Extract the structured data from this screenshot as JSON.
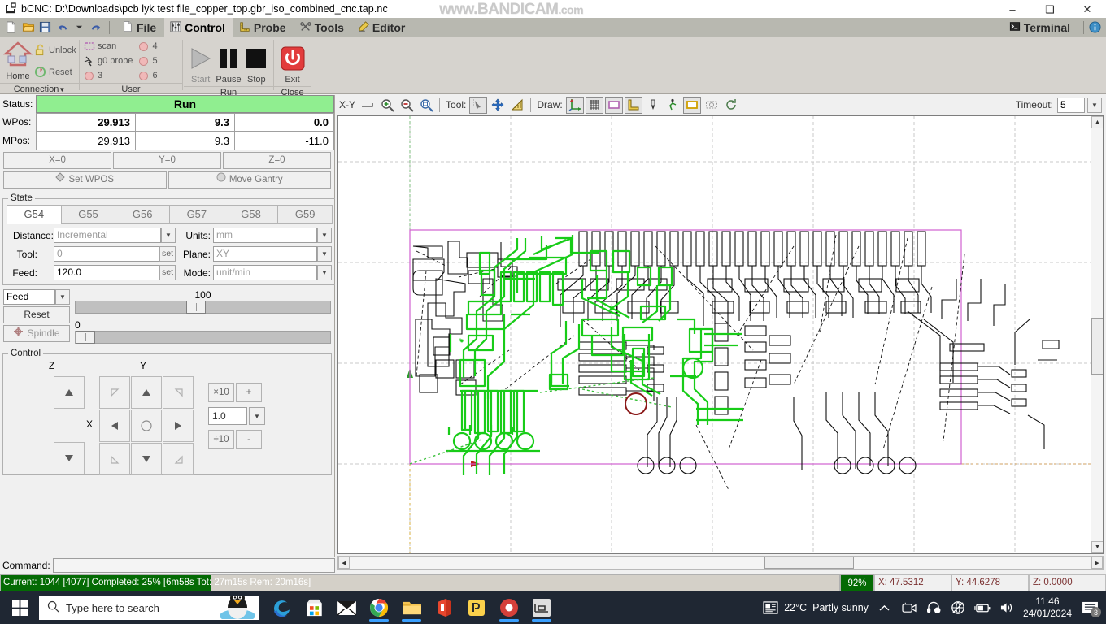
{
  "window": {
    "title": "bCNC: D:\\Downloads\\pcb lyk test file_copper_top.gbr_iso_combined_cnc.tap.nc",
    "icon": "bcnc-icon",
    "minimize": "–",
    "maximize": "❑",
    "close": "✕",
    "watermark_main": "www.BANDICAM",
    "watermark_suffix": ".com"
  },
  "tabs": {
    "quick_access": [
      "new-file-icon",
      "open-folder-icon",
      "save-icon",
      "undo-icon",
      "dropdown-icon",
      "redo-icon"
    ],
    "items": [
      {
        "label": "File",
        "icon": "file-icon",
        "active": false
      },
      {
        "label": "Control",
        "icon": "sliders-icon",
        "active": true
      },
      {
        "label": "Probe",
        "icon": "ruler-icon",
        "active": false
      },
      {
        "label": "Tools",
        "icon": "tools-icon",
        "active": false
      },
      {
        "label": "Editor",
        "icon": "pencil-icon",
        "active": false
      }
    ],
    "right_items": [
      {
        "label": "Terminal",
        "icon": "terminal-icon"
      },
      {
        "label": "",
        "icon": "info-icon"
      }
    ]
  },
  "ribbon": {
    "groups": [
      {
        "caption": "Connection",
        "caption_arrow": "▼",
        "buttons": [
          {
            "label": "Home",
            "icon": "home-icon"
          },
          {
            "label": "Unlock",
            "icon": "unlock-icon"
          },
          {
            "label": "Reset",
            "icon": "reset-icon"
          }
        ]
      },
      {
        "caption": "User",
        "buttons": [
          {
            "label": "scan",
            "icon": "scan-icon"
          },
          {
            "label": "g0 probe",
            "icon": "g0probe-icon"
          },
          {
            "label": "3",
            "icon": "user-button-icon"
          },
          {
            "label": "4",
            "icon": "user-button-icon"
          },
          {
            "label": "5",
            "icon": "user-button-icon"
          },
          {
            "label": "6",
            "icon": "user-button-icon"
          }
        ]
      },
      {
        "caption": "Run",
        "buttons": [
          {
            "label": "Start",
            "icon": "play-icon",
            "disabled": true
          },
          {
            "label": "Pause",
            "icon": "pause-icon",
            "disabled": false
          },
          {
            "label": "Stop",
            "icon": "stop-icon",
            "disabled": false
          }
        ]
      },
      {
        "caption": "Close",
        "buttons": [
          {
            "label": "Exit",
            "icon": "power-icon"
          }
        ]
      }
    ]
  },
  "left_panel": {
    "status_label": "Status:",
    "status_value": "Run",
    "status_color": "#90ee90",
    "wpos_label": "WPos:",
    "wpos": [
      "29.913",
      "9.3",
      "0.0"
    ],
    "mpos_label": "MPos:",
    "mpos": [
      "29.913",
      "9.3",
      "-11.0"
    ],
    "zero_buttons": [
      "X=0",
      "Y=0",
      "Z=0"
    ],
    "set_wpos": "Set WPOS",
    "move_gantry": "Move Gantry",
    "state": {
      "legend": "State",
      "gtabs": [
        "G54",
        "G55",
        "G56",
        "G57",
        "G58",
        "G59"
      ],
      "gtab_selected": "G54",
      "fields": [
        {
          "label": "Distance:",
          "value": "Incremental",
          "type": "combo"
        },
        {
          "label": "Units:",
          "value": "mm",
          "type": "combo"
        },
        {
          "label": "Tool:",
          "value": "0",
          "type": "set",
          "set_label": "set"
        },
        {
          "label": "Plane:",
          "value": "XY",
          "type": "combo"
        },
        {
          "label": "Feed:",
          "value": "120.0",
          "type": "set",
          "set_label": "set"
        },
        {
          "label": "Mode:",
          "value": "unit/min",
          "type": "combo"
        }
      ]
    },
    "overrides": {
      "feed_combo": "Feed",
      "reset_label": "Reset",
      "spindle_label": "Spindle",
      "feed_value": "100",
      "feed_pct": 100,
      "spindle_value": "0",
      "spindle_pct": 0
    },
    "control": {
      "legend": "Control",
      "z_label": "Z",
      "y_label": "Y",
      "x_label": "X",
      "step_mult": "×10",
      "step_plus": "+",
      "step_div": "÷10",
      "step_minus": "-",
      "step_value": "1.0"
    },
    "command_label": "Command:",
    "command_value": ""
  },
  "canvas_toolbar": {
    "view_label": "X-Y",
    "view_icon": "view-dropdown-icon",
    "zoom_in": "zoom-in-icon",
    "zoom_out": "zoom-out-icon",
    "zoom_fit": "zoom-fit-icon",
    "tool_label": "Tool:",
    "tool_icons": [
      "select-icon",
      "pan-icon",
      "ruler-tool-icon"
    ],
    "draw_label": "Draw:",
    "draw_icons": [
      "axes-icon",
      "grid-icon",
      "margin-icon",
      "probe-draw-icon",
      "endmill-icon",
      "path-icon",
      "workarea-icon",
      "camera-icon",
      "rapid-icon"
    ],
    "timeout_label": "Timeout:",
    "timeout_value": "5"
  },
  "status_bar": {
    "progress_text": "Current: 1044 [4077]  Completed: 25% [6m58s Tot: 27m15s Rem: 20m16s]",
    "progress_pct": 25,
    "zoom_pct": "92%",
    "coord_x": "X: 47.5312",
    "coord_y": "Y: 44.6278",
    "coord_z": "Z: 0.0000"
  },
  "taskbar": {
    "start_icon": "windows-start-icon",
    "search_placeholder": "Type here to search",
    "search_icon": "search-icon",
    "apps": [
      {
        "name": "edge-icon",
        "active": false
      },
      {
        "name": "microsoft-store-icon",
        "active": false
      },
      {
        "name": "mail-icon",
        "active": false
      },
      {
        "name": "chrome-icon",
        "active": true
      },
      {
        "name": "file-explorer-icon",
        "active": true
      },
      {
        "name": "office-icon",
        "active": false
      },
      {
        "name": "pdf-icon",
        "active": false
      },
      {
        "name": "record-icon",
        "active": true
      },
      {
        "name": "bcnc-taskbar-icon",
        "active": true
      }
    ],
    "weather_temp": "22°C",
    "weather_desc": "Partly sunny",
    "tray_icons": [
      "chevron-up-icon",
      "camera-tray-icon",
      "headset-icon",
      "network-icon",
      "battery-icon",
      "volume-icon"
    ],
    "time": "11:46",
    "date": "24/01/2024",
    "notification_count": "3"
  }
}
